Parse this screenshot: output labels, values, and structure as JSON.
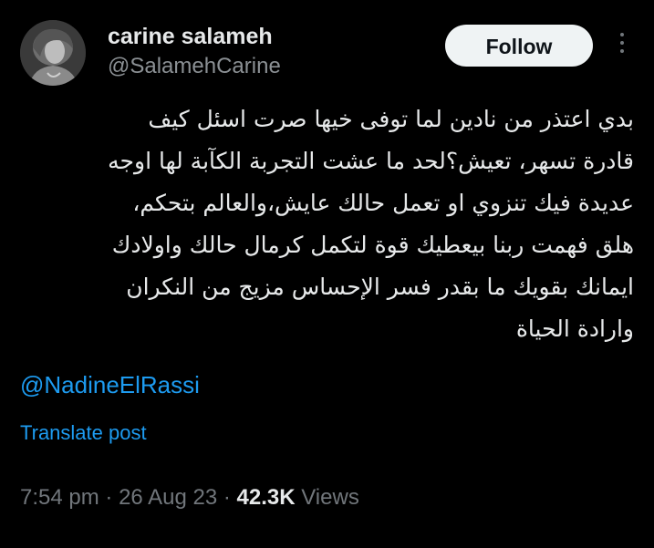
{
  "user": {
    "display_name": "carine salameh",
    "handle": "@SalamehCarine",
    "avatar_icon": "profile-photo"
  },
  "follow_label": "Follow",
  "more_icon": "more-options-icon",
  "tweet": {
    "lines": [
      "بدي اعتذر  من نادين لما توفى خيها صرت اسئل  كيف",
      "قادرة  تسهر، تعيش؟لحد ما  عشت التجربة الكآبة لها اوجه",
      "عديدة فيك تنزوي  او تعمل حالك عايش،والعالم بتحكم،",
      "هلق فهمت ربنا بيعطيك قوة لتكمل كرمال حالك واولادك",
      "ايمانك بقويك ما بقدر فسر الإحساس مزيج من النكران",
      "وارادة الحياة"
    ],
    "mention": "@NadineElRassi",
    "translate_label": "Translate post"
  },
  "meta": {
    "time": "7:54 pm",
    "separator": "·",
    "date": "26 Aug 23",
    "views_count": "42.3K",
    "views_label": "Views"
  },
  "colors": {
    "background": "#000000",
    "text": "#e7e9ea",
    "secondary": "#71767b",
    "link": "#1d9bf0",
    "button_bg": "#eff3f4"
  }
}
